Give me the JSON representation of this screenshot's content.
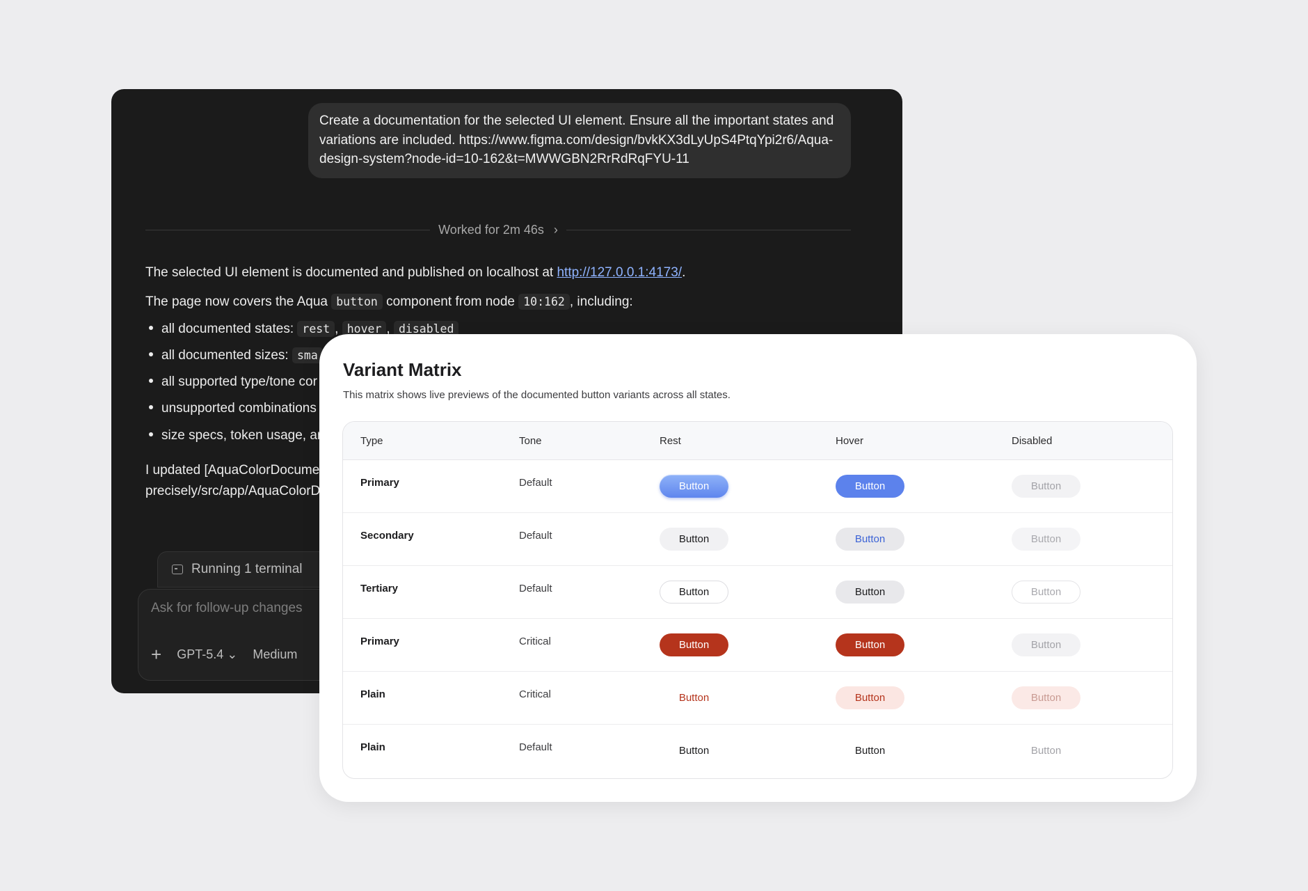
{
  "chat": {
    "user_message": "Create a documentation for the selected UI element. Ensure all the important states and variations are included. https://www.figma.com/design/bvkKX3dLyUpS4PtqYpi2r6/Aqua-design-system?node-id=10-162&t=MWWGBN2RrRdRqFYU-11",
    "worked_label": "Worked for 2m 46s",
    "line1_prefix": "The selected UI element is documented and published on localhost at ",
    "line1_link": "http://127.0.0.1:4173/",
    "line1_suffix": ".",
    "line2_a": "The page now covers the Aqua ",
    "line2_code1": "button",
    "line2_b": " component from node ",
    "line2_code2": "10:162",
    "line2_c": ", including:",
    "bullets": {
      "b1_text": "all documented states:",
      "b1_code1": "rest",
      "b1_code2": "hover",
      "b1_code3": "disabled",
      "b2_text": "all documented sizes:",
      "b2_code1": "sma",
      "b3_text": "all supported type/tone cor",
      "b4_text": "unsupported combinations",
      "b5_text": "size specs, token usage, ar"
    },
    "line3": "I updated [AquaColorDocume",
    "line4": "precisely/src/app/AquaColorD",
    "terminal_label": "Running 1 terminal",
    "composer_placeholder": "Ask for follow-up changes",
    "model_label": "GPT-5.4",
    "effort_label": "Medium"
  },
  "matrix": {
    "title": "Variant Matrix",
    "subtitle": "This matrix shows live previews of the documented button variants across all states.",
    "headers": {
      "type": "Type",
      "tone": "Tone",
      "rest": "Rest",
      "hover": "Hover",
      "disabled": "Disabled"
    },
    "button_label": "Button",
    "rows": [
      {
        "type": "Primary",
        "tone": "Default"
      },
      {
        "type": "Secondary",
        "tone": "Default"
      },
      {
        "type": "Tertiary",
        "tone": "Default"
      },
      {
        "type": "Primary",
        "tone": "Critical"
      },
      {
        "type": "Plain",
        "tone": "Critical"
      },
      {
        "type": "Plain",
        "tone": "Default"
      }
    ]
  },
  "colors": {
    "primary_blue": "#5c82ec",
    "critical_red": "#b5341c",
    "link_blue": "#8fb3ff",
    "chat_bg": "#1b1b1b",
    "page_bg": "#ededef"
  }
}
